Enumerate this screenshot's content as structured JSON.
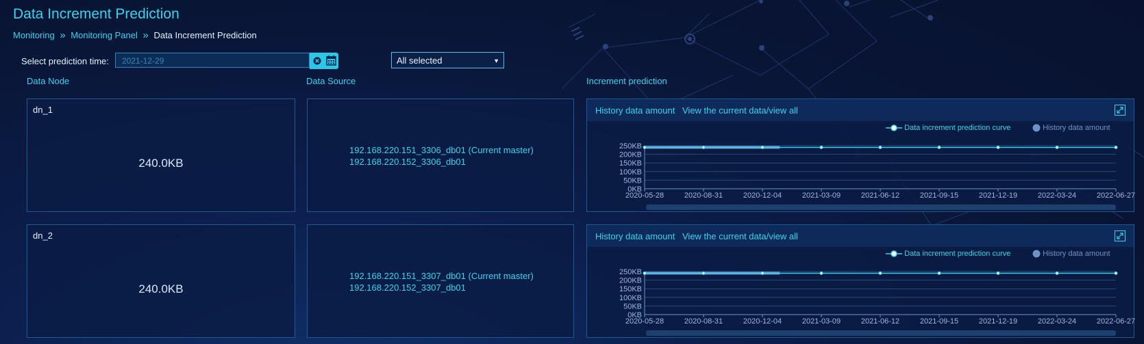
{
  "page": {
    "title": "Data Increment Prediction",
    "breadcrumb": [
      "Monitoring",
      "Monitoring Panel",
      "Data Increment Prediction"
    ],
    "breadcrumb_sep": "»"
  },
  "filters": {
    "time_label": "Select prediction time:",
    "date_value": "2021-12-29",
    "select_value": "All selected"
  },
  "columns": {
    "node": "Data Node",
    "source": "Data Source",
    "prediction": "Increment prediction"
  },
  "rows": [
    {
      "node": "dn_1",
      "size": "240.0KB",
      "sources": [
        "192.168.220.151_3306_db01  (Current master)",
        "192.168.220.152_3306_db01"
      ]
    },
    {
      "node": "dn_2",
      "size": "240.0KB",
      "sources": [
        "192.168.220.151_3307_db01  (Current master)",
        "192.168.220.152_3307_db01"
      ]
    }
  ],
  "chart_tabs": {
    "history": "History data amount",
    "view": "View the current data/view all"
  },
  "colors": {
    "accent": "#38d4ee",
    "history_series": "#6f93c8",
    "panel_border": "#1f5a92"
  },
  "chart_data": [
    {
      "type": "line",
      "x_ticks": [
        "2020-05-28",
        "2020-08-31",
        "2020-12-04",
        "2021-03-09",
        "2021-06-12",
        "2021-09-15",
        "2021-12-19",
        "2022-03-24",
        "2022-06-27"
      ],
      "y_ticks": [
        "250KB",
        "200KB",
        "150KB",
        "100KB",
        "50KB",
        "0KB"
      ],
      "ylim": [
        0,
        250
      ],
      "y_unit": "KB",
      "legend": "top-right",
      "grid": true,
      "series": [
        {
          "name": "Data increment prediction curve",
          "x": [
            "2020-05-28",
            "2020-08-31",
            "2020-12-04",
            "2021-03-09",
            "2021-06-12",
            "2021-09-15",
            "2021-12-19",
            "2022-03-24",
            "2022-06-27"
          ],
          "values": [
            240,
            240,
            240,
            240,
            240,
            240,
            240,
            240,
            240
          ]
        },
        {
          "name": "History data amount",
          "x": [
            "2020-05-28",
            "2020-08-31",
            "2020-12-04",
            "2021-01-01"
          ],
          "values": [
            240,
            240,
            240,
            240
          ]
        }
      ]
    },
    {
      "type": "line",
      "x_ticks": [
        "2020-05-28",
        "2020-08-31",
        "2020-12-04",
        "2021-03-09",
        "2021-06-12",
        "2021-09-15",
        "2021-12-19",
        "2022-03-24",
        "2022-06-27"
      ],
      "y_ticks": [
        "250KB",
        "200KB",
        "150KB",
        "100KB",
        "50KB",
        "0KB"
      ],
      "ylim": [
        0,
        250
      ],
      "y_unit": "KB",
      "legend": "top-right",
      "grid": true,
      "series": [
        {
          "name": "Data increment prediction curve",
          "x": [
            "2020-05-28",
            "2020-08-31",
            "2020-12-04",
            "2021-03-09",
            "2021-06-12",
            "2021-09-15",
            "2021-12-19",
            "2022-03-24",
            "2022-06-27"
          ],
          "values": [
            240,
            240,
            240,
            240,
            240,
            240,
            240,
            240,
            240
          ]
        },
        {
          "name": "History data amount",
          "x": [
            "2020-05-28",
            "2020-08-31",
            "2020-12-04",
            "2021-01-01"
          ],
          "values": [
            240,
            240,
            240,
            240
          ]
        }
      ]
    }
  ]
}
